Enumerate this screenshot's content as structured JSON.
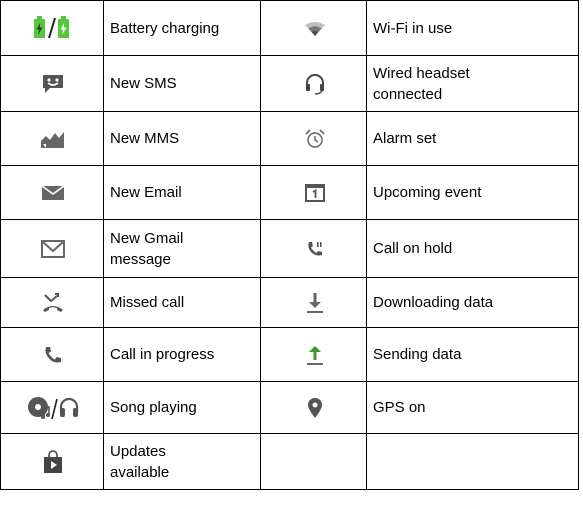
{
  "rows": [
    {
      "left": {
        "icon": "battery-charging-icon",
        "label": "Battery charging"
      },
      "right": {
        "icon": "wifi-icon",
        "label": "Wi-Fi in use"
      }
    },
    {
      "left": {
        "icon": "sms-icon",
        "label": "New SMS"
      },
      "right": {
        "icon": "headset-icon",
        "label": "Wired headset connected"
      }
    },
    {
      "left": {
        "icon": "mms-icon",
        "label": "New MMS"
      },
      "right": {
        "icon": "alarm-icon",
        "label": "Alarm set"
      }
    },
    {
      "left": {
        "icon": "email-icon",
        "label": "New Email"
      },
      "right": {
        "icon": "calendar-icon",
        "label": "Upcoming event"
      }
    },
    {
      "left": {
        "icon": "gmail-icon",
        "label": "New Gmail message"
      },
      "right": {
        "icon": "call-hold-icon",
        "label": "Call on hold"
      }
    },
    {
      "left": {
        "icon": "missed-call-icon",
        "label": "Missed call"
      },
      "right": {
        "icon": "download-icon",
        "label": "Downloading data"
      }
    },
    {
      "left": {
        "icon": "call-progress-icon",
        "label": "Call in progress"
      },
      "right": {
        "icon": "upload-icon",
        "label": "Sending data"
      }
    },
    {
      "left": {
        "icon": "song-playing-icon",
        "label": "Song playing"
      },
      "right": {
        "icon": "gps-icon",
        "label": "GPS on"
      }
    },
    {
      "left": {
        "icon": "updates-icon",
        "label": "Updates available"
      },
      "right": {
        "icon": "",
        "label": ""
      }
    }
  ],
  "colors": {
    "icon_gray": "#555555",
    "battery_green": "#58c63a",
    "arrow_green": "#3c9a2a",
    "text": "#000000",
    "border": "#000000"
  }
}
